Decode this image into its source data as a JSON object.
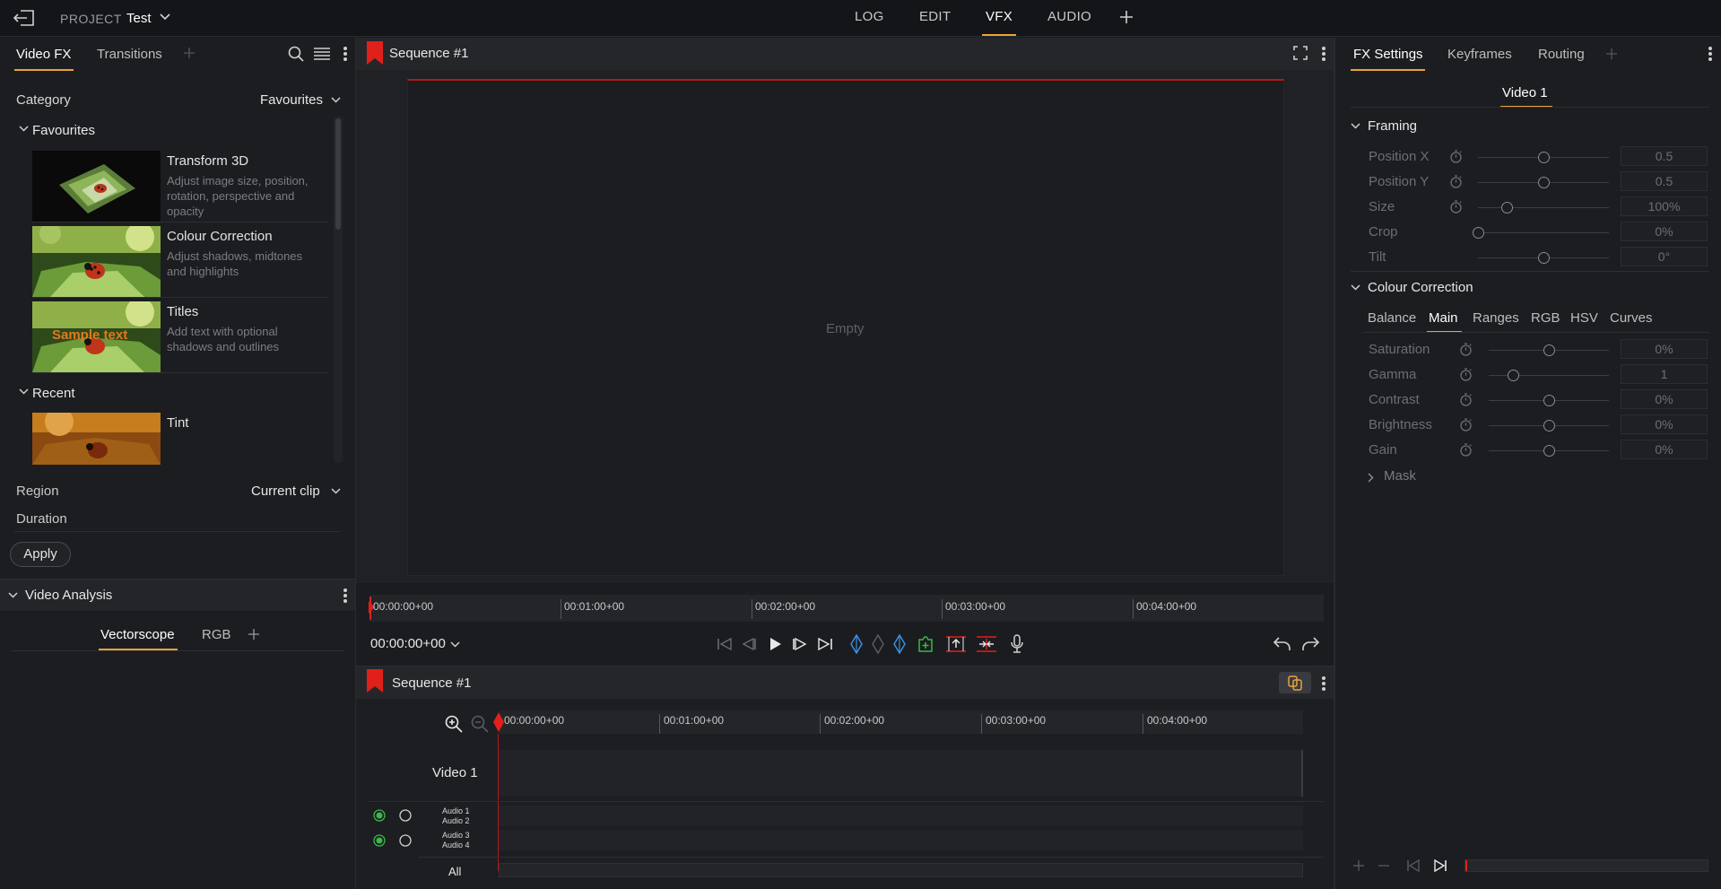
{
  "topbar": {
    "project_label": "PROJECT",
    "project_name": "Test",
    "modes": [
      "LOG",
      "EDIT",
      "VFX",
      "AUDIO"
    ],
    "active_mode": "VFX"
  },
  "left_panel": {
    "tabs": [
      "Video FX",
      "Transitions"
    ],
    "category_label": "Category",
    "category_value": "Favourites",
    "favourites_header": "Favourites",
    "effects": [
      {
        "title": "Transform 3D",
        "desc": "Adjust image size, position, rotation, perspective and opacity"
      },
      {
        "title": "Colour Correction",
        "desc": "Adjust shadows, midtones and highlights"
      },
      {
        "title": "Titles",
        "desc": "Add text with optional shadows and outlines",
        "overlay": "Sample text"
      }
    ],
    "recent_header": "Recent",
    "recent": [
      {
        "title": "Tint"
      }
    ],
    "region_label": "Region",
    "region_value": "Current clip",
    "duration_label": "Duration",
    "apply_label": "Apply"
  },
  "analysis_panel": {
    "title": "Video Analysis",
    "tabs": [
      "Vectorscope",
      "RGB"
    ]
  },
  "viewer": {
    "title": "Sequence #1",
    "empty_text": "Empty",
    "ruler": [
      "00:00:00+00",
      "00:01:00+00",
      "00:02:00+00",
      "00:03:00+00",
      "00:04:00+00"
    ],
    "timecode": "00:00:00+00"
  },
  "timeline": {
    "title": "Sequence #1",
    "ruler": [
      "00:00:00+00",
      "00:01:00+00",
      "00:02:00+00",
      "00:03:00+00",
      "00:04:00+00"
    ],
    "video_track": "Video 1",
    "audio_pair_1": [
      "Audio 1",
      "Audio 2"
    ],
    "audio_pair_2": [
      "Audio 3",
      "Audio 4"
    ],
    "all_label": "All"
  },
  "right_panel": {
    "tabs": [
      "FX Settings",
      "Keyframes",
      "Routing"
    ],
    "clip_tab": "Video 1",
    "framing_header": "Framing",
    "framing_params": [
      {
        "label": "Position X",
        "value": "0.5",
        "level": 0.5
      },
      {
        "label": "Position Y",
        "value": "0.5",
        "level": 0.5
      },
      {
        "label": "Size",
        "value": "100%",
        "level": 0.22
      },
      {
        "label": "Crop",
        "value": "0%",
        "level": 0.0
      },
      {
        "label": "Tilt",
        "value": "0°",
        "level": 0.5
      }
    ],
    "cc_header": "Colour Correction",
    "cc_tabs": [
      "Balance",
      "Main",
      "Ranges",
      "RGB",
      "HSV",
      "Curves"
    ],
    "cc_active_tab": "Main",
    "cc_params": [
      {
        "label": "Saturation",
        "value": "0%",
        "level": 0.5
      },
      {
        "label": "Gamma",
        "value": "1",
        "level": 0.2
      },
      {
        "label": "Contrast",
        "value": "0%",
        "level": 0.5
      },
      {
        "label": "Brightness",
        "value": "0%",
        "level": 0.5
      },
      {
        "label": "Gain",
        "value": "0%",
        "level": 0.5
      }
    ],
    "mask_label": "Mask"
  },
  "colors": {
    "accent": "#e8a33a",
    "playhead": "#e0201b",
    "marker_blue": "#3a8fe0",
    "marker_green": "#3ab84a"
  }
}
